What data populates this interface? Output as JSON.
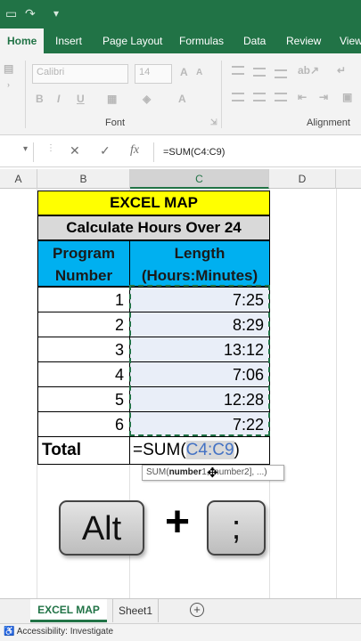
{
  "ribbon": {
    "tabs": [
      "Home",
      "Insert",
      "Page Layout",
      "Formulas",
      "Data",
      "Review",
      "View"
    ],
    "font_name": "Calibri",
    "font_size": "14",
    "groups": [
      "Font",
      "Alignment"
    ]
  },
  "formula_bar": {
    "formula": "=SUM(C4:C9)"
  },
  "columns": [
    "A",
    "B",
    "C",
    "D"
  ],
  "table": {
    "title": "EXCEL MAP",
    "subtitle": "Calculate Hours Over 24",
    "header_b": [
      "Program",
      "Number"
    ],
    "header_c": [
      "Length",
      "(Hours:Minutes)"
    ],
    "rows": [
      {
        "number": "1",
        "length": "7:25"
      },
      {
        "number": "2",
        "length": "8:29"
      },
      {
        "number": "3",
        "length": "13:12"
      },
      {
        "number": "4",
        "length": "7:06"
      },
      {
        "number": "5",
        "length": "12:28"
      },
      {
        "number": "6",
        "length": "7:22"
      }
    ],
    "total_label": "Total",
    "total_formula_prefix": "=SUM(",
    "total_formula_range": "C4:C9",
    "total_formula_suffix": ")"
  },
  "tooltip": {
    "prefix": "SUM(",
    "bold": "number",
    "rest": "1, [number2], ...)"
  },
  "keys": {
    "key1": "Alt",
    "plus": "+",
    "key2": ";"
  },
  "sheet_tabs": [
    "EXCEL MAP",
    "Sheet1"
  ],
  "status": {
    "text": "Accessibility: Investigate"
  },
  "colors": {
    "excel_green": "#217346",
    "title_fill": "#ffff00",
    "subtitle_fill": "#d9d9d9",
    "header_fill": "#00b0f0",
    "range_text": "#4472c4"
  }
}
